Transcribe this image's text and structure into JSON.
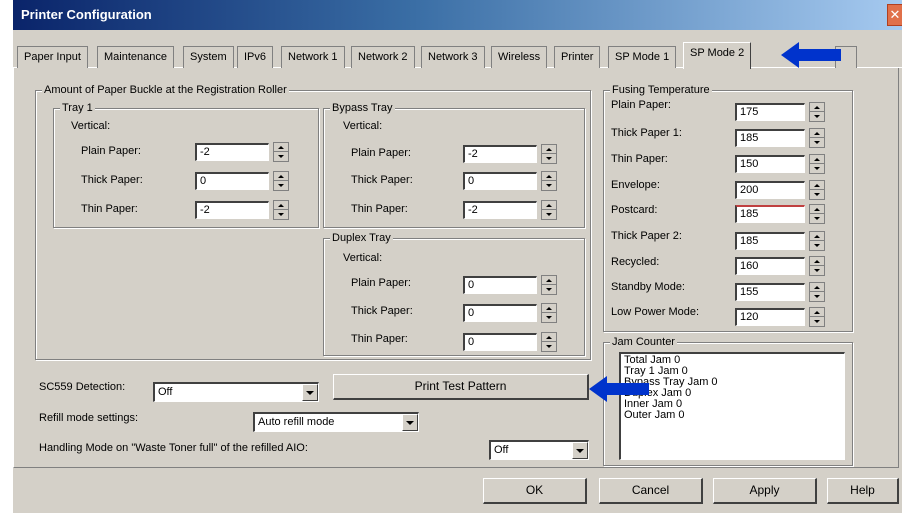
{
  "window": {
    "title": "Printer Configuration"
  },
  "tabs": [
    "Paper Input",
    "Maintenance",
    "System",
    "IPv6",
    "Network 1",
    "Network 2",
    "Network 3",
    "Wireless",
    "Printer",
    "SP Mode 1",
    "SP Mode 2"
  ],
  "buckle": {
    "title": "Amount of Paper Buckle at the Registration Roller",
    "tray1": {
      "title": "Tray 1",
      "vertical": "Vertical:",
      "rows": [
        {
          "label": "Plain Paper:",
          "value": "-2"
        },
        {
          "label": "Thick Paper:",
          "value": "0"
        },
        {
          "label": "Thin Paper:",
          "value": "-2"
        }
      ]
    },
    "bypass": {
      "title": "Bypass Tray",
      "vertical": "Vertical:",
      "rows": [
        {
          "label": "Plain Paper:",
          "value": "-2"
        },
        {
          "label": "Thick Paper:",
          "value": "0"
        },
        {
          "label": "Thin Paper:",
          "value": "-2"
        }
      ]
    },
    "duplex": {
      "title": "Duplex Tray",
      "vertical": "Vertical:",
      "rows": [
        {
          "label": "Plain Paper:",
          "value": "0"
        },
        {
          "label": "Thick Paper:",
          "value": "0"
        },
        {
          "label": "Thin Paper:",
          "value": "0"
        }
      ]
    }
  },
  "fusing": {
    "title": "Fusing Temperature",
    "rows": [
      {
        "label": "Plain Paper:",
        "value": "175"
      },
      {
        "label": "Thick Paper 1:",
        "value": "185"
      },
      {
        "label": "Thin Paper:",
        "value": "150"
      },
      {
        "label": "Envelope:",
        "value": "200"
      },
      {
        "label": "Postcard:",
        "value": "185"
      },
      {
        "label": "Thick Paper 2:",
        "value": "185"
      },
      {
        "label": "Recycled:",
        "value": "160"
      },
      {
        "label": "Standby Mode:",
        "value": "155"
      },
      {
        "label": "Low Power Mode:",
        "value": "120"
      }
    ]
  },
  "jam": {
    "title": "Jam Counter",
    "lines": [
      "Total Jam  0",
      "Tray 1 Jam  0",
      "Bypass Tray Jam  0",
      "Duplex Jam  0",
      "Inner Jam  0",
      "Outer Jam  0"
    ]
  },
  "sc559": {
    "label": "SC559 Detection:",
    "value": "Off"
  },
  "print_test_label": "Print Test Pattern",
  "refill": {
    "label": "Refill mode settings:",
    "value": "Auto refill mode"
  },
  "handling": {
    "label": "Handling Mode on \"Waste Toner full\" of the refilled AIO:",
    "value": "Off"
  },
  "buttons": {
    "ok": "OK",
    "cancel": "Cancel",
    "apply": "Apply",
    "help": "Help"
  },
  "colors": {
    "arrow": "#0033cc",
    "title_bar": "#0a246a",
    "dialog_bg": "#d4d0c8"
  }
}
